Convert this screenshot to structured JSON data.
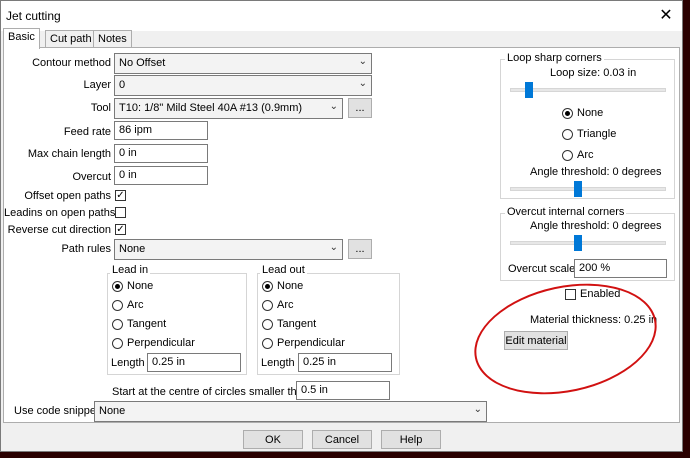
{
  "window": {
    "title": "Jet cutting",
    "close_glyph": "✕"
  },
  "tabs": [
    {
      "label": "Basic"
    },
    {
      "label": "Cut path"
    },
    {
      "label": "Notes"
    }
  ],
  "basic": {
    "contour_method": {
      "label": "Contour method",
      "value": "No Offset"
    },
    "layer": {
      "label": "Layer",
      "value": "0"
    },
    "tool": {
      "label": "Tool",
      "value": "T10: 1/8\" Mild Steel 40A #13 (0.9mm)",
      "browse": "..."
    },
    "feed_rate": {
      "label": "Feed rate",
      "value": "86 ipm"
    },
    "max_chain_length": {
      "label": "Max chain length",
      "value": "0 in"
    },
    "overcut": {
      "label": "Overcut",
      "value": "0 in"
    },
    "offset_open_paths": {
      "label": "Offset open paths",
      "checked": true
    },
    "leadins_on_open_paths": {
      "label": "Leadins on open paths",
      "checked": false
    },
    "reverse_cut_direction": {
      "label": "Reverse cut direction",
      "checked": true
    },
    "path_rules": {
      "label": "Path rules",
      "value": "None",
      "browse": "..."
    },
    "lead_in": {
      "title": "Lead in",
      "options": [
        "None",
        "Arc",
        "Tangent",
        "Perpendicular"
      ],
      "selected": "None",
      "length_label": "Length",
      "length_value": "0.25 in"
    },
    "lead_out": {
      "title": "Lead out",
      "options": [
        "None",
        "Arc",
        "Tangent",
        "Perpendicular"
      ],
      "selected": "None",
      "length_label": "Length",
      "length_value": "0.25 in"
    },
    "start_centre": {
      "label": "Start at the centre of circles smaller than",
      "value": "0.5 in"
    },
    "code_snippet": {
      "label": "Use code snippet",
      "value": "None"
    }
  },
  "loop_sharp_corners": {
    "title": "Loop sharp corners",
    "loop_size_label": "Loop size: 0.03 in",
    "loop_size_level": 0.1,
    "options": [
      "None",
      "Triangle",
      "Arc"
    ],
    "selected": "None",
    "angle_label": "Angle threshold: 0 degrees",
    "angle_level": 0.43
  },
  "overcut_internal": {
    "title": "Overcut internal corners",
    "angle_label": "Angle threshold: 0 degrees",
    "angle_level": 0.43,
    "scale_label": "Overcut scale",
    "scale_value": "200 %",
    "enabled": {
      "label": "Enabled",
      "checked": false
    }
  },
  "material": {
    "thickness_label": "Material thickness: 0.25 in",
    "edit_button": "Edit material"
  },
  "footer": {
    "ok": "OK",
    "cancel": "Cancel",
    "help": "Help"
  },
  "colors": {
    "annotation": "#d11111",
    "slider_thumb": "#0078d7",
    "background": "#2a0000"
  }
}
